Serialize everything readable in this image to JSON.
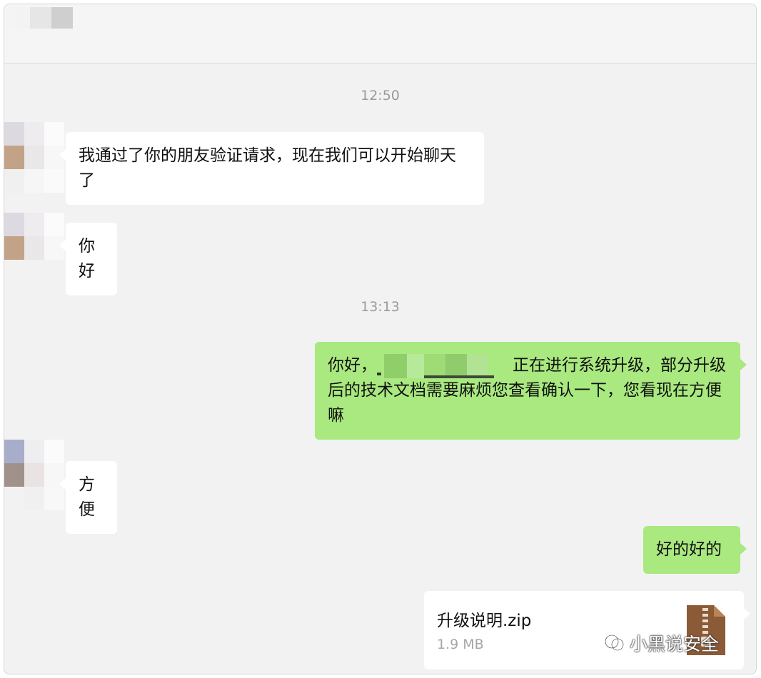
{
  "chat": {
    "timestamps": [
      "12:50",
      "13:13"
    ],
    "messages": {
      "m1": "我通过了你的朋友验证请求，现在我们可以开始聊天了",
      "m2": "你好",
      "m3_prefix": "你好，",
      "m3_rest": "正在进行系统升级，部分升级后的技术文档需要麻烦您查看确认一下，您看现在方便嘛",
      "m4": "方便",
      "m5": "好的好的"
    },
    "file": {
      "name": "升级说明.zip",
      "size": "1.9 MB",
      "icon": "zip-archive-icon"
    }
  },
  "watermark": {
    "text": "小黑说安全",
    "icon": "wechat-official-account-icon"
  },
  "colors": {
    "sent_bubble": "#a9e97f",
    "received_bubble": "#ffffff",
    "background": "#f2f2f2",
    "zip_icon": "#8b5a36"
  }
}
